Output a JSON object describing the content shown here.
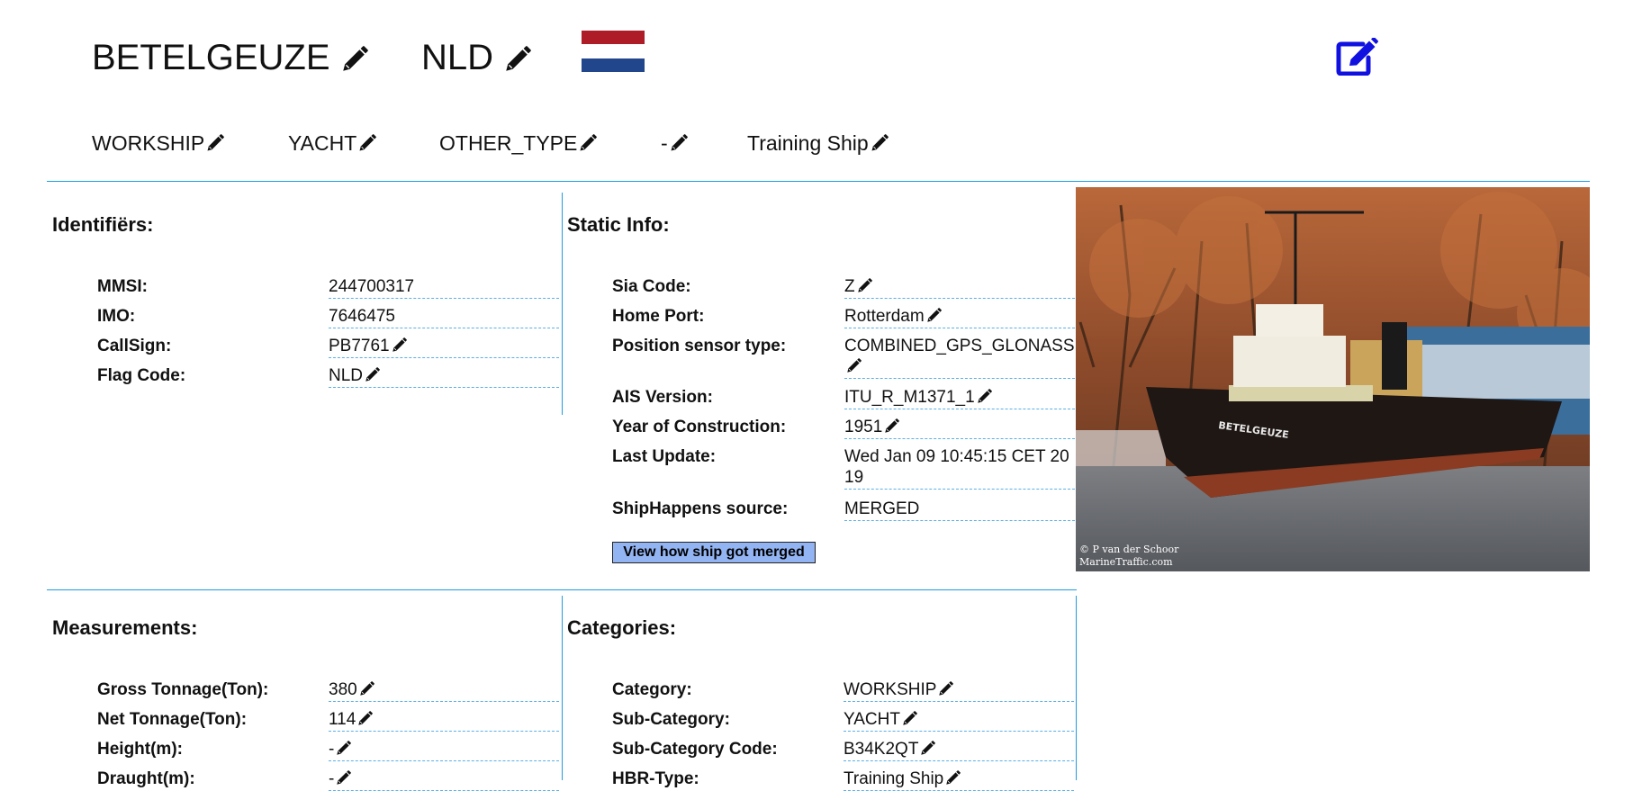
{
  "header": {
    "ship_name": "BETELGEUZE",
    "country_code": "NLD",
    "flag_colors": [
      "#ae1c28",
      "#ffffff",
      "#21468b"
    ],
    "edit_icon": "edit-square-icon",
    "edit_icon_color": "#1010e0"
  },
  "type_tags": [
    "WORKSHIP",
    "YACHT",
    "OTHER_TYPE",
    "-",
    "Training Ship"
  ],
  "identifiers": {
    "title": "Identifiërs:",
    "rows": [
      {
        "label": "MMSI:",
        "value": "244700317"
      },
      {
        "label": "IMO:",
        "value": "7646475"
      },
      {
        "label": "CallSign:",
        "value": "PB7761"
      },
      {
        "label": "Flag Code:",
        "value": "NLD"
      }
    ]
  },
  "static_info": {
    "title": "Static Info:",
    "rows": [
      {
        "label": "Sia Code:",
        "value": "Z"
      },
      {
        "label": "Home Port:",
        "value": "Rotterdam"
      },
      {
        "label": "Position sensor type:",
        "value": "COMBINED_GPS_GLONASS"
      },
      {
        "label": "AIS Version:",
        "value": "ITU_R_M1371_1"
      },
      {
        "label": "Year of Construction:",
        "value": "1951"
      },
      {
        "label": "Last Update:",
        "value": "Wed Jan 09 10:45:15 CET 2019"
      },
      {
        "label": "ShipHappens source:",
        "value": "MERGED"
      }
    ],
    "merge_button": "View how ship got merged"
  },
  "photo": {
    "hull_text": "BETELGEUZE",
    "credit_line1": "© P van der Schoor",
    "credit_line2": "MarineTraffic.com"
  },
  "measurements": {
    "title": "Measurements:",
    "rows": [
      {
        "label": "Gross Tonnage(Ton):",
        "value": "380"
      },
      {
        "label": "Net Tonnage(Ton):",
        "value": "114"
      },
      {
        "label": "Height(m):",
        "value": "-"
      },
      {
        "label": "Draught(m):",
        "value": "-"
      }
    ]
  },
  "categories": {
    "title": "Categories:",
    "rows": [
      {
        "label": "Category:",
        "value": "WORKSHIP"
      },
      {
        "label": "Sub-Category:",
        "value": "YACHT"
      },
      {
        "label": "Sub-Category Code:",
        "value": "B34K2QT"
      },
      {
        "label": "HBR-Type:",
        "value": "Training Ship"
      }
    ]
  },
  "colors": {
    "divider": "#1f9be0",
    "dashed_underline": "#5ab0e6",
    "button_bg": "#93b4f2"
  }
}
